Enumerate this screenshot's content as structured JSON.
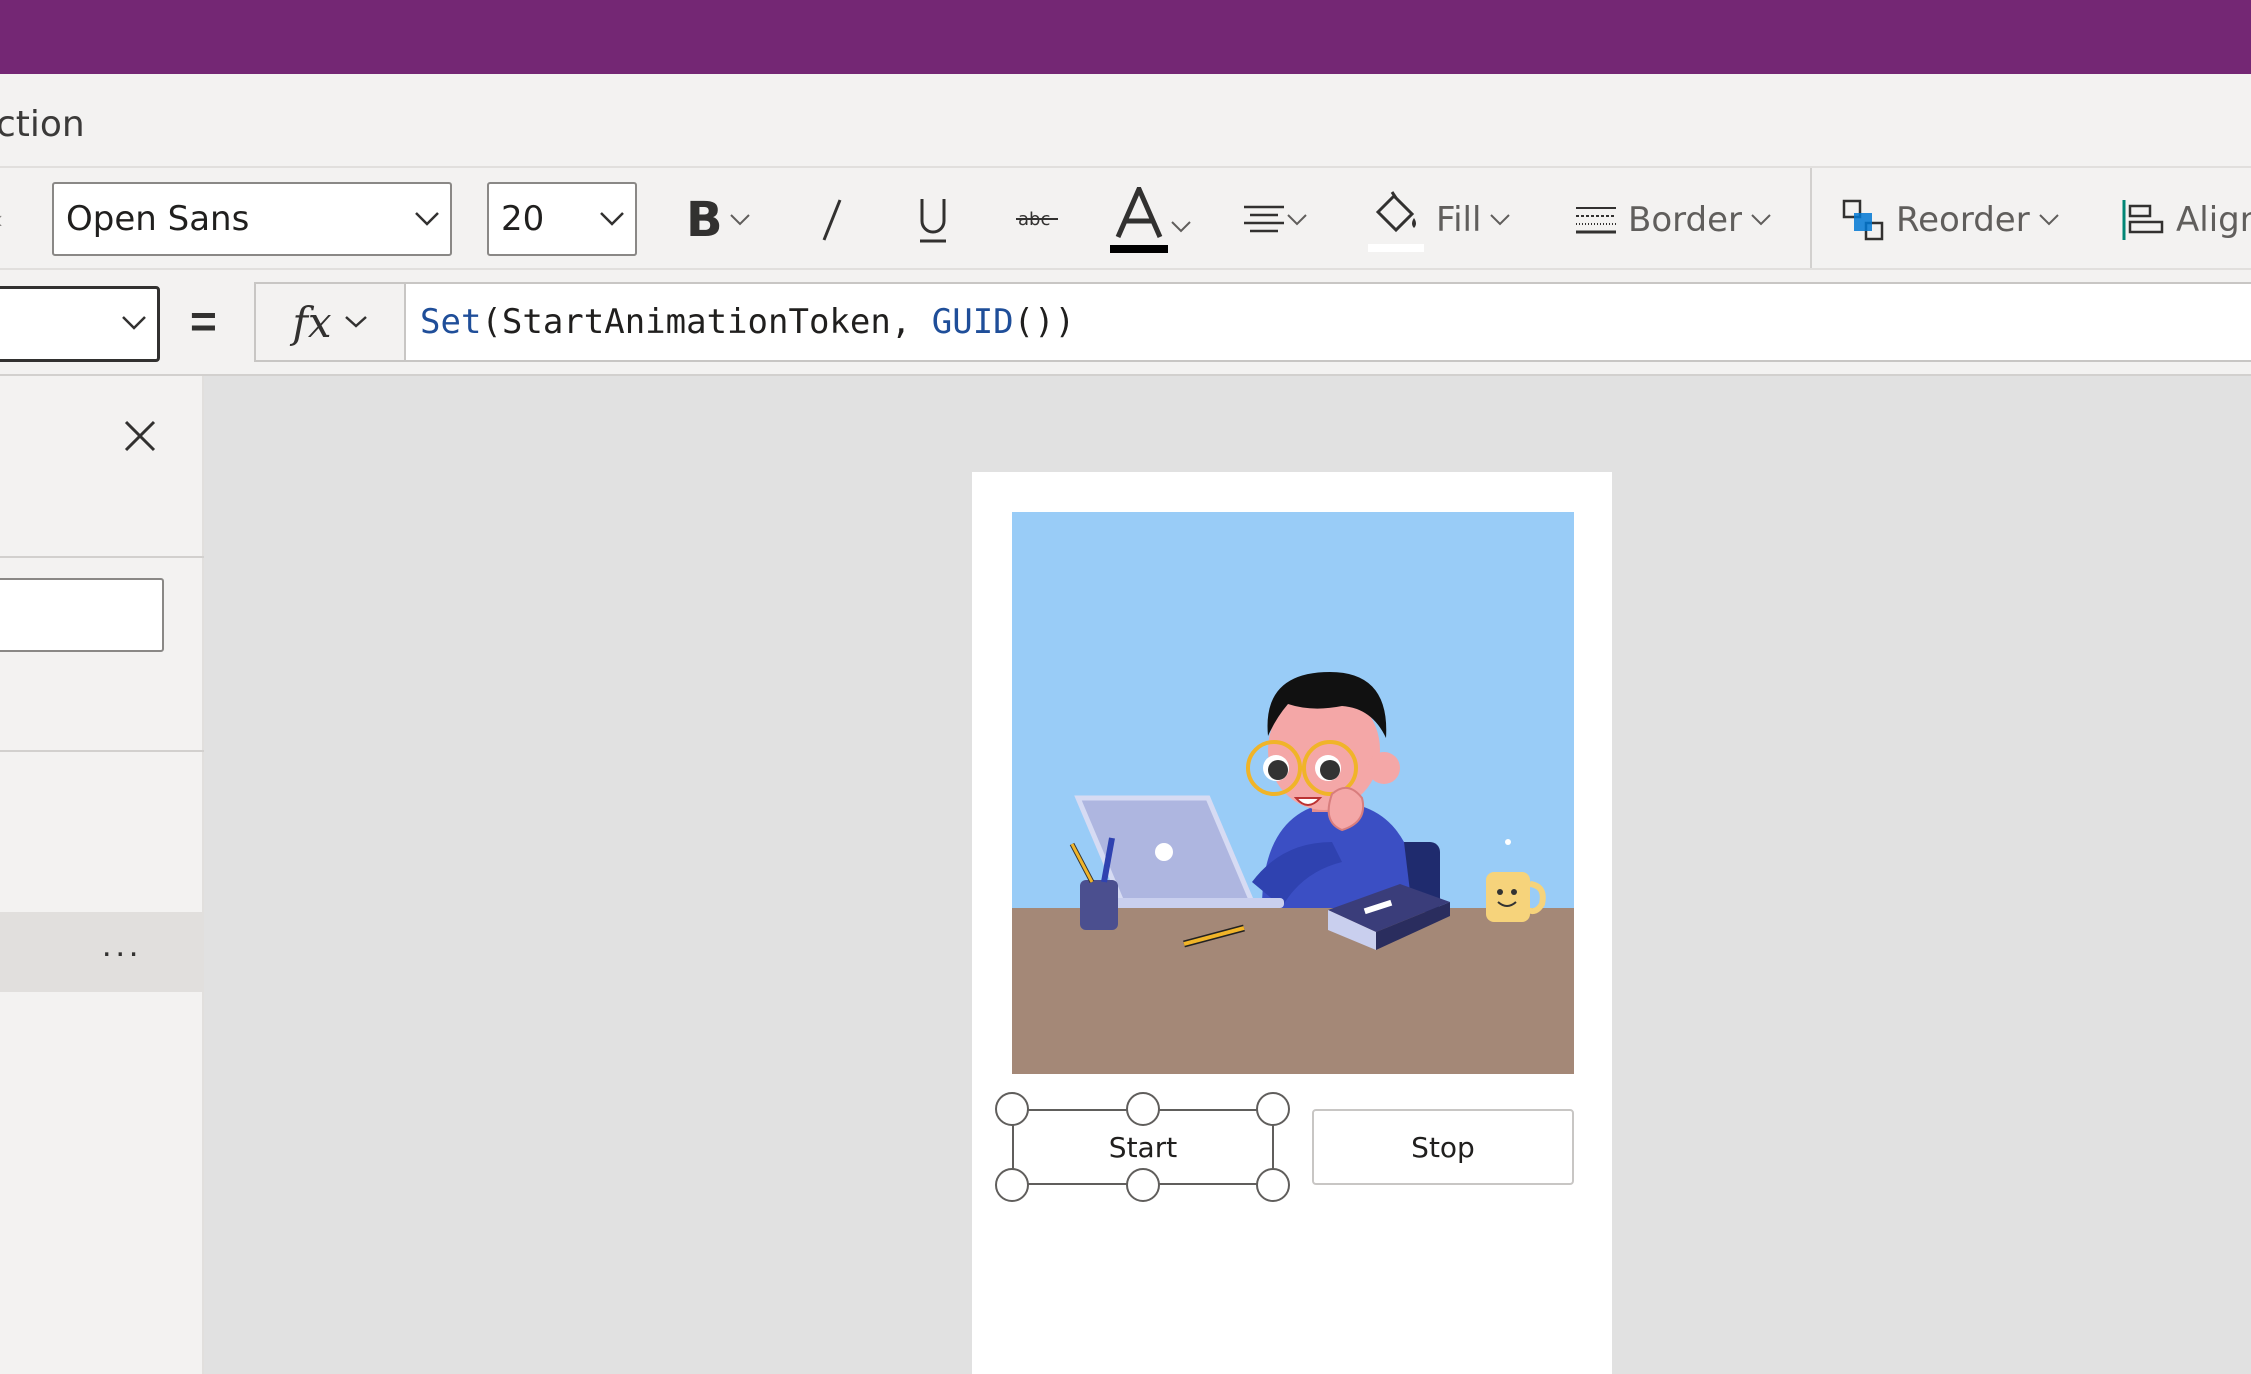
{
  "menubar": {
    "partial_text": "ction"
  },
  "ribbon": {
    "font_family": "Open Sans",
    "font_size": "20",
    "fill_label": "Fill",
    "border_label": "Border",
    "reorder_label": "Reorder",
    "align_label": "Align"
  },
  "formula_bar": {
    "equals": "=",
    "fx_label": "fx",
    "formula_tokens": [
      {
        "text": "Set",
        "kind": "function"
      },
      {
        "text": "(StartAnimationToken, ",
        "kind": "plain"
      },
      {
        "text": "GUID",
        "kind": "function"
      },
      {
        "text": "())",
        "kind": "plain"
      }
    ]
  },
  "left_panel": {
    "more_label": "..."
  },
  "canvas": {
    "start_label": "Start",
    "stop_label": "Stop"
  },
  "colors": {
    "titlebar": "#742774",
    "sky": "#99ccf7",
    "desk": "#a48877"
  }
}
